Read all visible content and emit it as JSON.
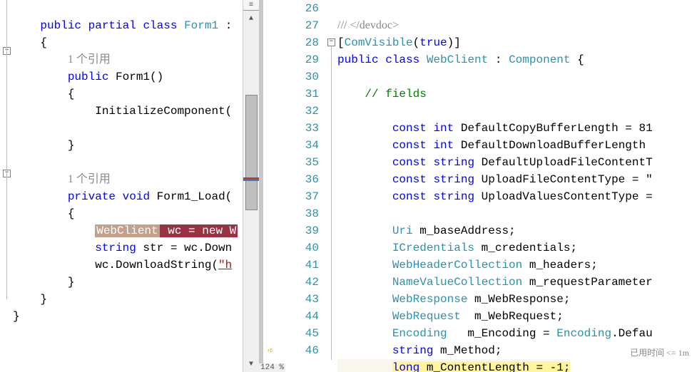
{
  "left": {
    "ref_text": "1 个引用",
    "lines": {
      "l0_kw1": "public",
      "l0_kw2": "partial",
      "l0_kw3": "class",
      "l0_type": "Form1",
      "l0_colon": " :",
      "l1_brace": "{",
      "l3_kw1": "public",
      "l3_name": " Form1()",
      "l4_brace": "{",
      "l5_call": "InitializeComponent(",
      "l6_brace": "}",
      "l8_kw1": "private",
      "l8_kw2": "void",
      "l8_name": " Form1_Load(",
      "l9_brace": "{",
      "l10_sel1": "WebClient",
      "l10_sel2": " wc = new W",
      "l11_kw": "string",
      "l11_rest": " str = wc.Down",
      "l12a": "wc.DownloadString(",
      "l12b": "\"h",
      "l13_brace": "}",
      "l14_brace": "}",
      "l15_brace": "}"
    }
  },
  "right": {
    "line_start": 26,
    "line_end": 46,
    "perf_label": "已用时间 <= 1m",
    "lines": {
      "l26_a": "/// </devdoc>",
      "l27_a": "[",
      "l27_b": "ComVisible",
      "l27_c": "(",
      "l27_d": "true",
      "l27_e": ")]",
      "l28_a": "public",
      "l28_b": "class",
      "l28_c": "WebClient",
      "l28_d": " : ",
      "l28_e": "Component",
      "l28_f": " {",
      "l30_a": "// fields",
      "l32_a": "const",
      "l32_b": "int",
      "l32_c": " DefaultCopyBufferLength = 81",
      "l33_a": "const",
      "l33_b": "int",
      "l33_c": " DefaultDownloadBufferLength",
      "l34_a": "const",
      "l34_b": "string",
      "l34_c": " DefaultUploadFileContentT",
      "l35_a": "const",
      "l35_b": "string",
      "l35_c": " UploadFileContentType = \"",
      "l36_a": "const",
      "l36_b": "string",
      "l36_c": " UploadValuesContentType =",
      "l38_a": "Uri",
      "l38_b": " m_baseAddress;",
      "l39_a": "ICredentials",
      "l39_b": " m_credentials;",
      "l40_a": "WebHeaderCollection",
      "l40_b": " m_headers;",
      "l41_a": "NameValueCollection",
      "l41_b": " m_requestParameter",
      "l42_a": "WebResponse",
      "l42_b": " m_WebResponse;",
      "l43_a": "WebRequest",
      "l43_b": "  m_WebRequest;",
      "l44_a": "Encoding",
      "l44_b": "   m_Encoding = ",
      "l44_c": "Encoding",
      "l44_d": ".Defau",
      "l45_a": "string",
      "l45_b": " m_Method;",
      "l46_a": "long",
      "l46_b": " m_ContentLength = -1;"
    }
  },
  "zoom": "124 %"
}
